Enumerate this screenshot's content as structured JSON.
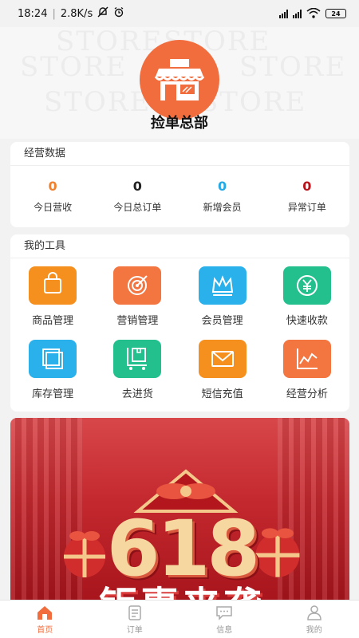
{
  "status_bar": {
    "time": "18:24",
    "speed": "2.8K/s",
    "battery": "24"
  },
  "header": {
    "watermark": "STORE",
    "store_name": "捡单总部"
  },
  "business": {
    "title": "经营数据",
    "stats": [
      {
        "value": "0",
        "label": "今日营收",
        "color": "#f0822f"
      },
      {
        "value": "0",
        "label": "今日总订单",
        "color": "#222222"
      },
      {
        "value": "0",
        "label": "新增会员",
        "color": "#24a9e6"
      },
      {
        "value": "0",
        "label": "异常订单",
        "color": "#b8141c"
      }
    ]
  },
  "tools": {
    "title": "我的工具",
    "items": [
      {
        "label": "商品管理",
        "icon": "shopping-bag-icon",
        "color": "#f5901f"
      },
      {
        "label": "营销管理",
        "icon": "target-icon",
        "color": "#f37540"
      },
      {
        "label": "会员管理",
        "icon": "crown-icon",
        "color": "#2ab0ea"
      },
      {
        "label": "快速收款",
        "icon": "yuan-coin-icon",
        "color": "#23c08e"
      },
      {
        "label": "库存管理",
        "icon": "inventory-icon",
        "color": "#2ab0ea"
      },
      {
        "label": "去进货",
        "icon": "cart-box-icon",
        "color": "#23c08e"
      },
      {
        "label": "短信充值",
        "icon": "envelope-icon",
        "color": "#f5901f"
      },
      {
        "label": "经营分析",
        "icon": "line-chart-icon",
        "color": "#f37540"
      }
    ]
  },
  "banner": {
    "big_text": "618",
    "sub_text": "钜惠来袭"
  },
  "tabbar": {
    "items": [
      {
        "label": "首页",
        "icon": "home-icon",
        "active": true
      },
      {
        "label": "订单",
        "icon": "order-icon",
        "active": false
      },
      {
        "label": "信息",
        "icon": "message-icon",
        "active": false
      },
      {
        "label": "我的",
        "icon": "user-icon",
        "active": false
      }
    ]
  },
  "colors": {
    "accent": "#f26d3d",
    "banner_red": "#c4292f"
  }
}
